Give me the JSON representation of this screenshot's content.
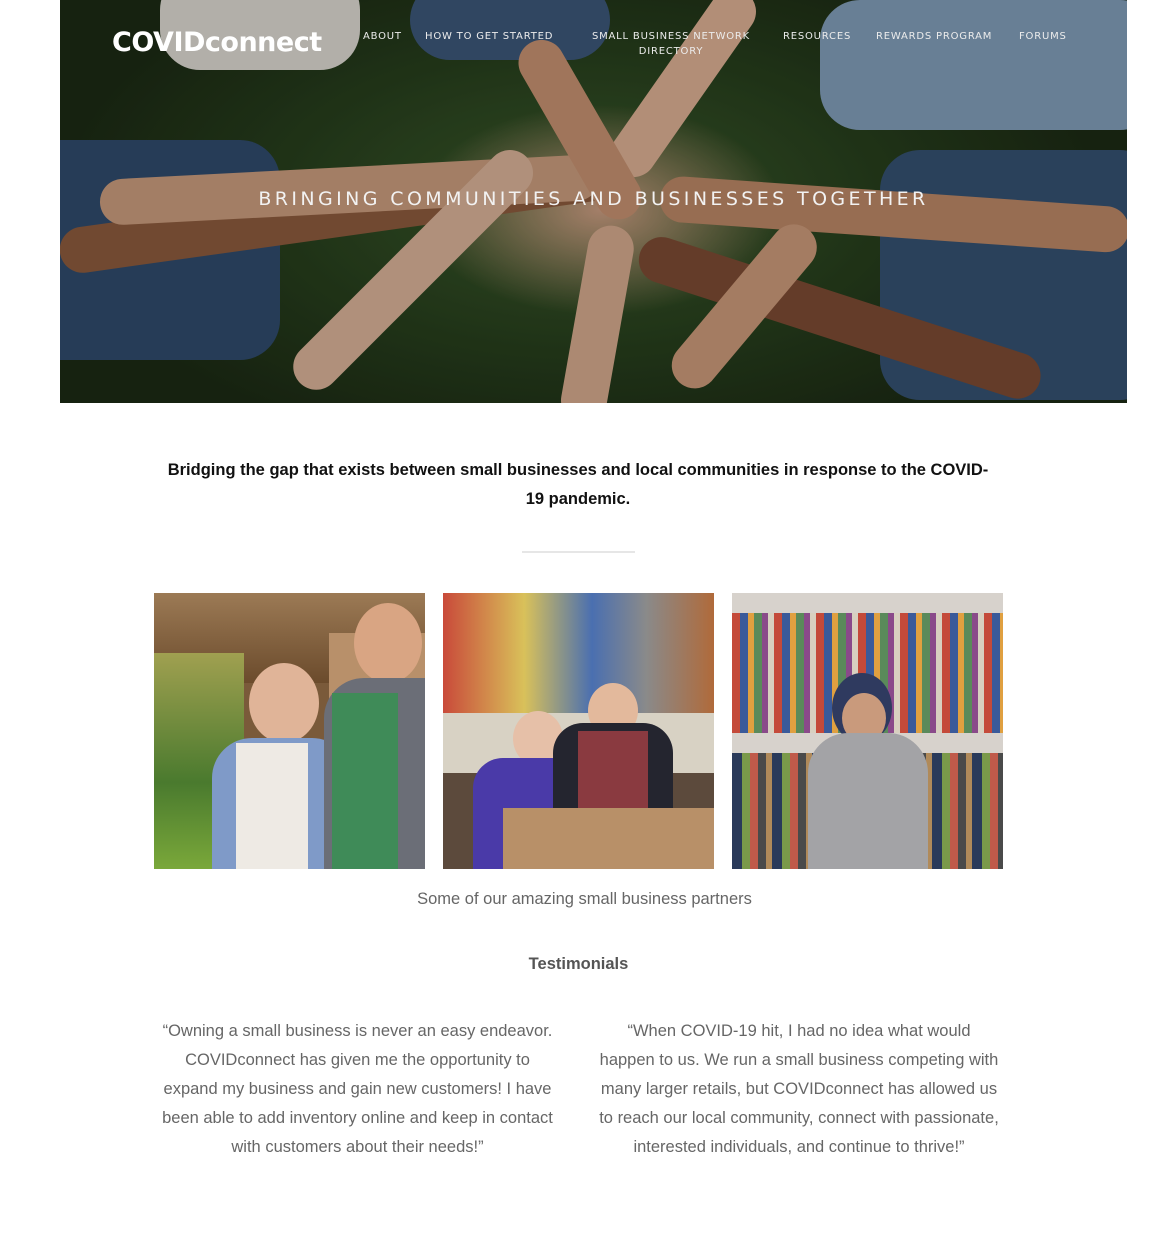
{
  "header": {
    "logo": "COVIDconnect",
    "nav": [
      {
        "label": "ABOUT"
      },
      {
        "label": "HOW TO GET STARTED"
      },
      {
        "label": "SMALL BUSINESS NETWORK DIRECTORY"
      },
      {
        "label": "RESOURCES"
      },
      {
        "label": "REWARDS PROGRAM"
      },
      {
        "label": "FORUMS"
      }
    ]
  },
  "hero": {
    "tagline": "BRINGING COMMUNITIES AND BUSINESSES TOGETHER"
  },
  "mission": {
    "text": "Bridging the gap that exists between small businesses and local communities in response to the COVID-19 pandemic."
  },
  "partners": {
    "photos": [
      {
        "subject": "grocery-store-owners"
      },
      {
        "subject": "hardware-store-owners"
      },
      {
        "subject": "clothing-store-shopper"
      }
    ],
    "caption": "Some of our amazing small business partners"
  },
  "testimonials": {
    "heading": "Testimonials",
    "quotes": [
      {
        "text": "“Owning a small business is never an easy endeavor. COVIDconnect has given me the opportunity to expand my business and gain new customers! I have been able to add inventory online and keep in contact with customers about their needs!”"
      },
      {
        "text": "“When COVID-19 hit, I had no idea what would happen to us. We run a small business competing with many larger retails, but COVIDconnect has allowed us to reach our local community, connect with passionate, interested individuals, and continue to thrive!”"
      }
    ]
  }
}
